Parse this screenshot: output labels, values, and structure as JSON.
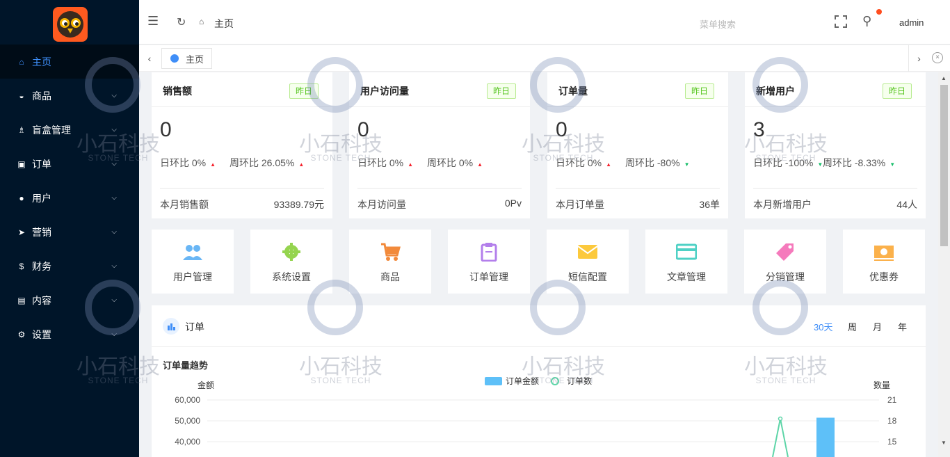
{
  "sidebar": {
    "items": [
      {
        "label": "主页",
        "icon": "home-icon",
        "active": true
      },
      {
        "label": "商品",
        "icon": "basket-icon",
        "active": false
      },
      {
        "label": "盲盒管理",
        "icon": "trophy-icon",
        "active": false
      },
      {
        "label": "订单",
        "icon": "cart-icon",
        "active": false
      },
      {
        "label": "用户",
        "icon": "user-icon",
        "active": false
      },
      {
        "label": "营销",
        "icon": "send-icon",
        "active": false
      },
      {
        "label": "财务",
        "icon": "dollar-icon",
        "active": false
      },
      {
        "label": "内容",
        "icon": "book-icon",
        "active": false
      },
      {
        "label": "设置",
        "icon": "gear-icon",
        "active": false
      }
    ],
    "colors": {
      "background": "#001529",
      "active_text": "#3f92ff"
    }
  },
  "header": {
    "breadcrumb": "主页",
    "search_placeholder": "菜单搜索",
    "username": "admin"
  },
  "tabs": [
    {
      "label": "主页"
    }
  ],
  "stats": [
    {
      "title": "销售额",
      "badge": "昨日",
      "value": "0",
      "daily": "日环比 0%",
      "daily_trend": "up",
      "weekly": "周环比 26.05%",
      "weekly_trend": "up",
      "footer_label": "本月销售额",
      "footer_value": "93389.79元"
    },
    {
      "title": "用户访问量",
      "badge": "昨日",
      "value": "0",
      "daily": "日环比 0%",
      "daily_trend": "up",
      "weekly": "周环比 0%",
      "weekly_trend": "up",
      "footer_label": "本月访问量",
      "footer_value": "0Pv"
    },
    {
      "title": "订单量",
      "badge": "昨日",
      "value": "0",
      "daily": "日环比 0%",
      "daily_trend": "up",
      "weekly": "周环比 -80%",
      "weekly_trend": "down",
      "footer_label": "本月订单量",
      "footer_value": "36单"
    },
    {
      "title": "新增用户",
      "badge": "昨日",
      "value": "3",
      "daily": "日环比 -100%",
      "daily_trend": "down",
      "weekly": "周环比 -8.33%",
      "weekly_trend": "down",
      "footer_label": "本月新增用户",
      "footer_value": "44人"
    }
  ],
  "quick_links": [
    {
      "label": "用户管理",
      "icon": "users-icon",
      "color": "#69b6f5"
    },
    {
      "label": "系统设置",
      "icon": "gear-icon",
      "color": "#95d44f"
    },
    {
      "label": "商品",
      "icon": "cart-icon",
      "color": "#f28a3b"
    },
    {
      "label": "订单管理",
      "icon": "clipboard-icon",
      "color": "#b37feb"
    },
    {
      "label": "短信配置",
      "icon": "mail-icon",
      "color": "#fcc93c"
    },
    {
      "label": "文章管理",
      "icon": "card-icon",
      "color": "#4fd1c5"
    },
    {
      "label": "分销管理",
      "icon": "tag-icon",
      "color": "#f57abc"
    },
    {
      "label": "优惠券",
      "icon": "coupon-icon",
      "color": "#fbb14b"
    }
  ],
  "orders_panel": {
    "title": "订单",
    "filters": [
      "30天",
      "周",
      "月",
      "年"
    ],
    "active_filter": "30天"
  },
  "chart_data": {
    "type": "bar",
    "title": "订单量趋势",
    "series": [
      {
        "name": "订单金额",
        "type": "bar",
        "axis": "left",
        "color": "#5ec0f8"
      },
      {
        "name": "订单数",
        "type": "line",
        "axis": "right",
        "color": "#5ed5a8"
      }
    ],
    "y_left": {
      "label": "金额",
      "ticks": [
        "60,000",
        "50,000",
        "40,000"
      ],
      "range": [
        40000,
        60000
      ]
    },
    "y_right": {
      "label": "数量",
      "ticks": [
        "21",
        "18",
        "15"
      ],
      "range": [
        15,
        21
      ]
    },
    "visible_points": {
      "order_amount_bar_peak": 51500,
      "order_count_line_peak": 18.3
    },
    "grid": true,
    "legend": "top-center"
  },
  "watermark": {
    "text": "小石科技",
    "sub": "STONE TECH"
  }
}
